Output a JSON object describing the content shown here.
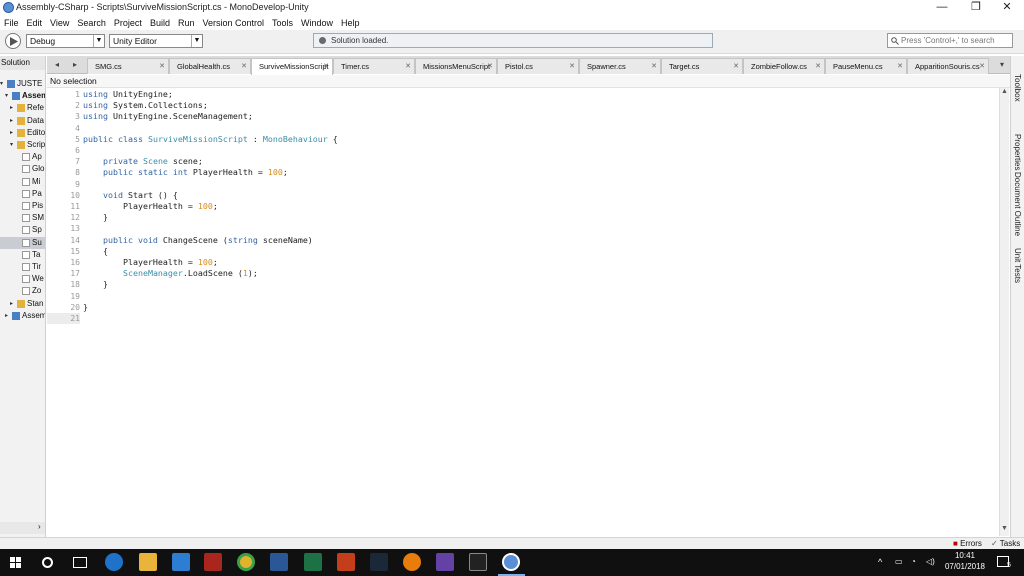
{
  "window": {
    "title": "Assembly-CSharp - Scripts\\SurviveMissionScript.cs - MonoDevelop-Unity",
    "controls": {
      "minimize": "—",
      "maximize": "❐",
      "close": "✕"
    }
  },
  "menu": [
    "File",
    "Edit",
    "View",
    "Search",
    "Project",
    "Build",
    "Run",
    "Version Control",
    "Tools",
    "Window",
    "Help"
  ],
  "toolbar": {
    "config": "Debug",
    "target": "Unity Editor",
    "status": "Solution loaded.",
    "search_placeholder": "Press 'Control+,' to search"
  },
  "solution": {
    "header": "Solution",
    "items": [
      {
        "label": "JUSTE U",
        "expanded": true
      },
      {
        "label": "Assem",
        "expanded": true,
        "bold": true
      },
      {
        "label": "Refe",
        "expanded": false
      },
      {
        "label": "Data",
        "expanded": false
      },
      {
        "label": "Edito",
        "expanded": false
      },
      {
        "label": "Scrip",
        "expanded": true
      },
      {
        "label": "Ap"
      },
      {
        "label": "Glo"
      },
      {
        "label": "Mi"
      },
      {
        "label": "Pa"
      },
      {
        "label": "Pis"
      },
      {
        "label": "SM"
      },
      {
        "label": "Sp"
      },
      {
        "label": "Su",
        "selected": true
      },
      {
        "label": "Ta"
      },
      {
        "label": "Tir"
      },
      {
        "label": "We"
      },
      {
        "label": "Zo"
      },
      {
        "label": "Stan",
        "expanded": false
      },
      {
        "label": "Assem",
        "expanded": false
      }
    ]
  },
  "tabs": [
    "SMG.cs",
    "GlobalHealth.cs",
    "SurviveMissionScript",
    "Timer.cs",
    "MissionsMenuScript",
    "Pistol.cs",
    "Spawner.cs",
    "Target.cs",
    "ZombieFollow.cs",
    "PauseMenu.cs",
    "ApparitionSouris.cs"
  ],
  "active_tab": 2,
  "editor": {
    "selection": "No selection",
    "lines": [
      [
        [
          "kw",
          "using"
        ],
        [
          "pl",
          " UnityEngine;"
        ]
      ],
      [
        [
          "kw",
          "using"
        ],
        [
          "pl",
          " System.Collections;"
        ]
      ],
      [
        [
          "kw",
          "using"
        ],
        [
          "pl",
          " UnityEngine.SceneManagement;"
        ]
      ],
      [],
      [
        [
          "kw",
          "public class"
        ],
        [
          "pl",
          " "
        ],
        [
          "ty",
          "SurviveMissionScript"
        ],
        [
          "pl",
          " : "
        ],
        [
          "ty",
          "MonoBehaviour"
        ],
        [
          "pl",
          " {"
        ]
      ],
      [],
      [
        [
          "pl",
          "    "
        ],
        [
          "kw",
          "private"
        ],
        [
          "pl",
          " "
        ],
        [
          "ty",
          "Scene"
        ],
        [
          "pl",
          " scene;"
        ]
      ],
      [
        [
          "pl",
          "    "
        ],
        [
          "kw",
          "public static int"
        ],
        [
          "pl",
          " PlayerHealth = "
        ],
        [
          "num",
          "100"
        ],
        [
          "pl",
          ";"
        ]
      ],
      [],
      [
        [
          "pl",
          "    "
        ],
        [
          "kw",
          "void"
        ],
        [
          "pl",
          " Start () {"
        ]
      ],
      [
        [
          "pl",
          "        PlayerHealth = "
        ],
        [
          "num",
          "100"
        ],
        [
          "pl",
          ";"
        ]
      ],
      [
        [
          "pl",
          "    }"
        ]
      ],
      [],
      [
        [
          "pl",
          "    "
        ],
        [
          "kw",
          "public void"
        ],
        [
          "pl",
          " ChangeScene ("
        ],
        [
          "kw",
          "string"
        ],
        [
          "pl",
          " sceneName)"
        ]
      ],
      [
        [
          "pl",
          "    {"
        ]
      ],
      [
        [
          "pl",
          "        PlayerHealth = "
        ],
        [
          "num",
          "100"
        ],
        [
          "pl",
          ";"
        ]
      ],
      [
        [
          "pl",
          "        "
        ],
        [
          "ty",
          "SceneManager"
        ],
        [
          "pl",
          ".LoadScene ("
        ],
        [
          "num",
          "1"
        ],
        [
          "pl",
          ");"
        ]
      ],
      [
        [
          "pl",
          "    }"
        ]
      ],
      [],
      [
        [
          "pl",
          "}"
        ]
      ],
      []
    ],
    "current_line": 21
  },
  "right_dock": [
    "Toolbox",
    "Properties",
    "Document Outline",
    "Unit Tests"
  ],
  "bottom": {
    "errors": "Errors",
    "tasks": "Tasks"
  },
  "taskbar": {
    "time": "10:41",
    "date": "07/01/2018",
    "notifications": "5"
  },
  "colors": {
    "keyword": "#3365a4",
    "type": "#3a8fa8",
    "number": "#d88a1b",
    "taskbar": "#101010"
  }
}
